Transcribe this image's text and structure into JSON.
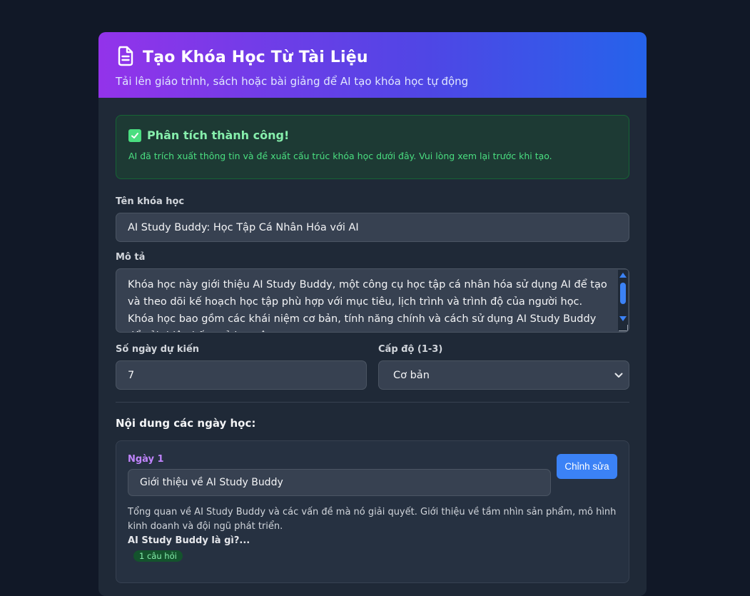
{
  "header": {
    "title": "Tạo Khóa Học Từ Tài Liệu",
    "subtitle": "Tải lên giáo trình, sách hoặc bài giảng để AI tạo khóa học tự động"
  },
  "success": {
    "title": "Phân tích thành công!",
    "message": "AI đã trích xuất thông tin và đề xuất cấu trúc khóa học dưới đây. Vui lòng xem lại trước khi tạo."
  },
  "form": {
    "course_name_label": "Tên khóa học",
    "course_name_value": "AI Study Buddy: Học Tập Cá Nhân Hóa với AI",
    "description_label": "Mô tả",
    "description_value": "Khóa học này giới thiệu AI Study Buddy, một công cụ học tập cá nhân hóa sử dụng AI để tạo và theo dõi kế hoạch học tập phù hợp với mục tiêu, lịch trình và trình độ của người học. Khóa học bao gồm các khái niệm cơ bản, tính năng chính và cách sử dụng AI Study Buddy để cải thiện kết quả học tập.",
    "days_label": "Số ngày dự kiến",
    "days_value": "7",
    "level_label": "Cấp độ (1-3)",
    "level_value": "Cơ bản"
  },
  "days_section": {
    "title": "Nội dung các ngày học:",
    "days": [
      {
        "label": "Ngày 1",
        "title": "Giới thiệu về AI Study Buddy",
        "edit_label": "Chỉnh sửa",
        "description": "Tổng quan về AI Study Buddy và các vấn đề mà nó giải quyết. Giới thiệu về tầm nhìn sản phẩm, mô hình kinh doanh và đội ngũ phát triển.",
        "question": "AI Study Buddy là gì?...",
        "question_count": "1 câu hỏi"
      }
    ]
  },
  "icons": {
    "header": "document-icon",
    "success": "check-box-icon",
    "select": "chevron-down-icon"
  },
  "colors": {
    "background": "#111827",
    "card": "#1f2937",
    "gradient_start": "#9333ea",
    "gradient_end": "#2563eb",
    "success_text": "#4ade80",
    "accent_button": "#3b82f6",
    "day_label": "#c084fc"
  }
}
